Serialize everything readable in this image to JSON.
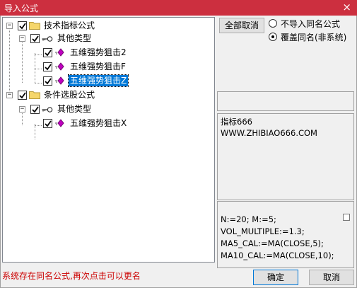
{
  "window": {
    "title": "导入公式",
    "close_glyph": "×"
  },
  "tree": {
    "nodes": [
      {
        "label": "技术指标公式",
        "checked": true,
        "expanded": true,
        "icon": "folder-icon"
      },
      {
        "label": "其他类型",
        "checked": true,
        "expanded": true,
        "icon": "key-icon"
      },
      {
        "label": "五维强势狙击2",
        "checked": true,
        "icon": "formula-diamond-icon"
      },
      {
        "label": "五维强势狙击F",
        "checked": true,
        "icon": "formula-diamond-icon"
      },
      {
        "label": "五维强势狙击Z",
        "checked": true,
        "icon": "formula-diamond-icon",
        "selected": true
      },
      {
        "label": "条件选股公式",
        "checked": true,
        "expanded": true,
        "icon": "folder-icon"
      },
      {
        "label": "其他类型",
        "checked": true,
        "expanded": true,
        "icon": "key-icon"
      },
      {
        "label": "五维强势狙击X",
        "checked": true,
        "icon": "formula-diamond-icon"
      }
    ]
  },
  "toolbar": {
    "cancel_all_label": "全部取消"
  },
  "options": {
    "no_import_label": "不导入同名公式",
    "overwrite_label": "覆盖同名(非系统)",
    "selected": "overwrite"
  },
  "info": {
    "line1": "指标666",
    "line2": "WWW.ZHIBIAO666.COM"
  },
  "code": {
    "lines": [
      "N:=20; M:=5;",
      "VOL_MULTIPLE:=1.3;",
      "MA5_CAL:=MA(CLOSE,5);",
      "MA10_CAL:=MA(CLOSE,10);"
    ]
  },
  "status": {
    "message": "系统存在同名公式,再次点击可以更名"
  },
  "footer": {
    "ok_label": "确定",
    "cancel_label": "取消"
  },
  "colors": {
    "titlebar": "#cc2f3f",
    "selection": "#0078d7",
    "status_text": "#cc0000",
    "formula_icon": "#c000c0"
  }
}
